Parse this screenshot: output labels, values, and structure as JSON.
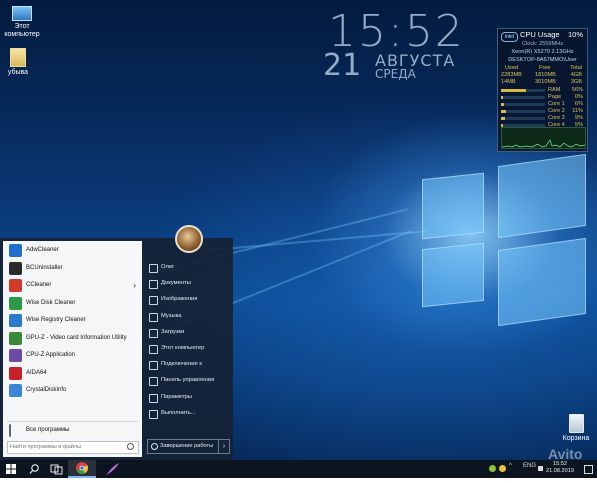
{
  "desktop": {
    "icons": [
      {
        "name": "computer-desktop-icon",
        "label_line1": "Этот",
        "label_line2": "компьютер"
      },
      {
        "name": "folder-desktop-icon",
        "label_line1": "убыва",
        "label_line2": ""
      },
      {
        "name": "recycle-bin-desktop-icon",
        "label_line1": "Корзина",
        "label_line2": ""
      }
    ]
  },
  "clock": {
    "time": "15:52",
    "day": "21",
    "month": "АВГУСТА",
    "weekday": "СРЕДА"
  },
  "cpu_gadget": {
    "title": "CPU Usage",
    "percent": "10%",
    "clock": "Clock: 2559MHz",
    "model": "Xeon(R) X5270 2.13GHz",
    "host": "DESKTOP-8A67MMO\\User",
    "headers": [
      "Used",
      "Free",
      "Total"
    ],
    "mem_rows": [
      {
        "used": "2283MB",
        "free": "1810MB",
        "total": "4GB"
      },
      {
        "used": "14MB",
        "free": "3010MB",
        "total": "3GB"
      }
    ],
    "meters": [
      {
        "label": "RAM",
        "value": "56%",
        "fraction": 0.56
      },
      {
        "label": "Page",
        "value": "0%",
        "fraction": 0.0
      },
      {
        "label": "Core 1",
        "value": "6%",
        "fraction": 0.06
      },
      {
        "label": "Core 2",
        "value": "11%",
        "fraction": 0.11
      },
      {
        "label": "Core 3",
        "value": "9%",
        "fraction": 0.09
      },
      {
        "label": "Core 4",
        "value": "5%",
        "fraction": 0.05
      }
    ]
  },
  "start_menu": {
    "user_avatar": "user-avatar",
    "apps": [
      {
        "label": "AdwCleaner",
        "icon": "adwcleaner-icon",
        "color": "#1e6fd0",
        "arrow": ""
      },
      {
        "label": "BCUninstaller",
        "icon": "bcuninstaller-icon",
        "color": "#2b2b2b",
        "arrow": ""
      },
      {
        "label": "CCleaner",
        "icon": "ccleaner-icon",
        "color": "#d23a2a",
        "arrow": "›"
      },
      {
        "label": "Wise Disk Cleaner",
        "icon": "wise-disk-cleaner-icon",
        "color": "#2a9a46",
        "arrow": ""
      },
      {
        "label": "Wise Registry Cleaner",
        "icon": "wise-registry-cleaner-icon",
        "color": "#2a7ad0",
        "arrow": ""
      },
      {
        "label": "GPU-Z - Video card Information Utility",
        "icon": "gpu-z-icon",
        "color": "#3a8a3a",
        "arrow": ""
      },
      {
        "label": "CPU-Z Application",
        "icon": "cpu-z-icon",
        "color": "#6b4aa8",
        "arrow": ""
      },
      {
        "label": "AIDA64",
        "icon": "aida64-icon",
        "color": "#c8202a",
        "arrow": ""
      },
      {
        "label": "CrystalDiskInfo",
        "icon": "crystaldiskinfo-icon",
        "color": "#3a86d6",
        "arrow": ""
      }
    ],
    "all_programs": "Все программы",
    "search_placeholder": "Найти программы и файлы",
    "places": [
      {
        "label": "Олег",
        "icon": "user-icon"
      },
      {
        "label": "Документы",
        "icon": "documents-icon"
      },
      {
        "label": "Изображения",
        "icon": "pictures-icon"
      },
      {
        "label": "Музыка",
        "icon": "music-icon"
      },
      {
        "label": "Загрузки",
        "icon": "downloads-icon"
      },
      {
        "label": "Этот компьютер",
        "icon": "computer-icon"
      },
      {
        "label": "Подключение к",
        "icon": "network-icon"
      },
      {
        "label": "Панель управления",
        "icon": "control-panel-icon"
      },
      {
        "label": "Параметры",
        "icon": "settings-icon"
      },
      {
        "label": "Выполнить...",
        "icon": "run-icon"
      }
    ],
    "shutdown_label": "Завершение работы",
    "shutdown_arrow": "›"
  },
  "taskbar": {
    "tray_lang": "ENG",
    "tray_time": "15:52",
    "tray_date": "21.08.2019",
    "tray_chevron": "^"
  },
  "watermark": "Avito"
}
